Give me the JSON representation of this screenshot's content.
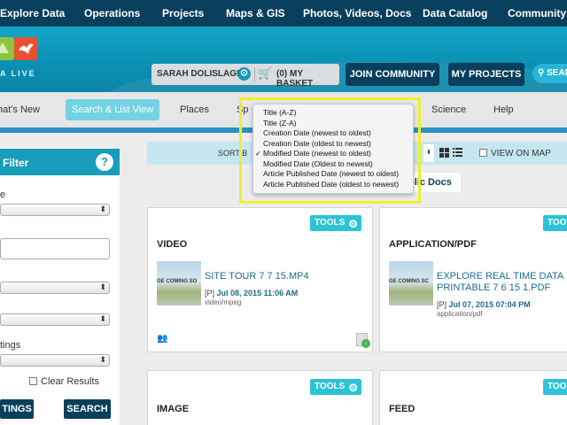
{
  "top_nav": [
    "Explore Data",
    "Operations",
    "Projects",
    "Maps & GIS",
    "Photos, Videos, Docs",
    "Data Catalog",
    "Community"
  ],
  "banner": {
    "logo_text": "A LIVE",
    "user_name": "SARAH DOLISLAGER",
    "basket": "(0) MY BASKET",
    "join_btn": "JOIN COMMUNITY",
    "projects_btn": "MY PROJECTS",
    "search_btn": "SEAR"
  },
  "sub_nav": [
    "hat's New",
    "Search & List View",
    "Places",
    "Sp",
    "Science",
    "Help"
  ],
  "filter": {
    "title": "Filter",
    "help": "?",
    "label_1": "e",
    "label_2": "tings",
    "clear_results": "Clear Results",
    "settings_btn": "TINGS",
    "search_btn": "SEARCH"
  },
  "sort": {
    "label": "SORT B",
    "view_on_map": "VIEW ON MAP",
    "public_docs_tab": "blic Docs",
    "options": [
      {
        "label": "Title (A-Z)",
        "checked": false
      },
      {
        "label": "Title (Z-A)",
        "checked": false
      },
      {
        "label": "Creation Date (newest to oldest)",
        "checked": false
      },
      {
        "label": "Creation Date (oldest to newest)",
        "checked": false
      },
      {
        "label": "Modified Date (newest to oldest)",
        "checked": true
      },
      {
        "label": "Modified Date (Oldest to newest)",
        "checked": false
      },
      {
        "label": "Article Published Date (newest to oldest)",
        "checked": false
      },
      {
        "label": "Article Published Date (oldest to newest)",
        "checked": false
      }
    ],
    "check_mark": "✓"
  },
  "cards": [
    {
      "type": "VIDEO",
      "tools": "TOOLS",
      "thumb_text": "GE COMING SO",
      "title": "SITE TOUR 7 7 15.MP4",
      "date_prefix": "[P]",
      "date": "Jul 08, 2015 11:06 AM",
      "mime": "video/mpeg"
    },
    {
      "type": "APPLICATION/PDF",
      "tools": "TOOL",
      "thumb_text": "GE COMING SC",
      "title": "EXPLORE REAL TIME DATA PRINTABLE 7 6 15 1.PDF",
      "date_prefix": "[P]",
      "date": "Jul 07, 2015 07:04 PM",
      "mime": "application/pdf"
    },
    {
      "type": "IMAGE",
      "tools": "TOOLS"
    },
    {
      "type": "FEED",
      "tools": "TOOL"
    }
  ],
  "colors": {
    "nav": "#083f5c",
    "accent": "#179db9",
    "tools": "#2dc3d7",
    "highlight": "#f0ef2a"
  }
}
